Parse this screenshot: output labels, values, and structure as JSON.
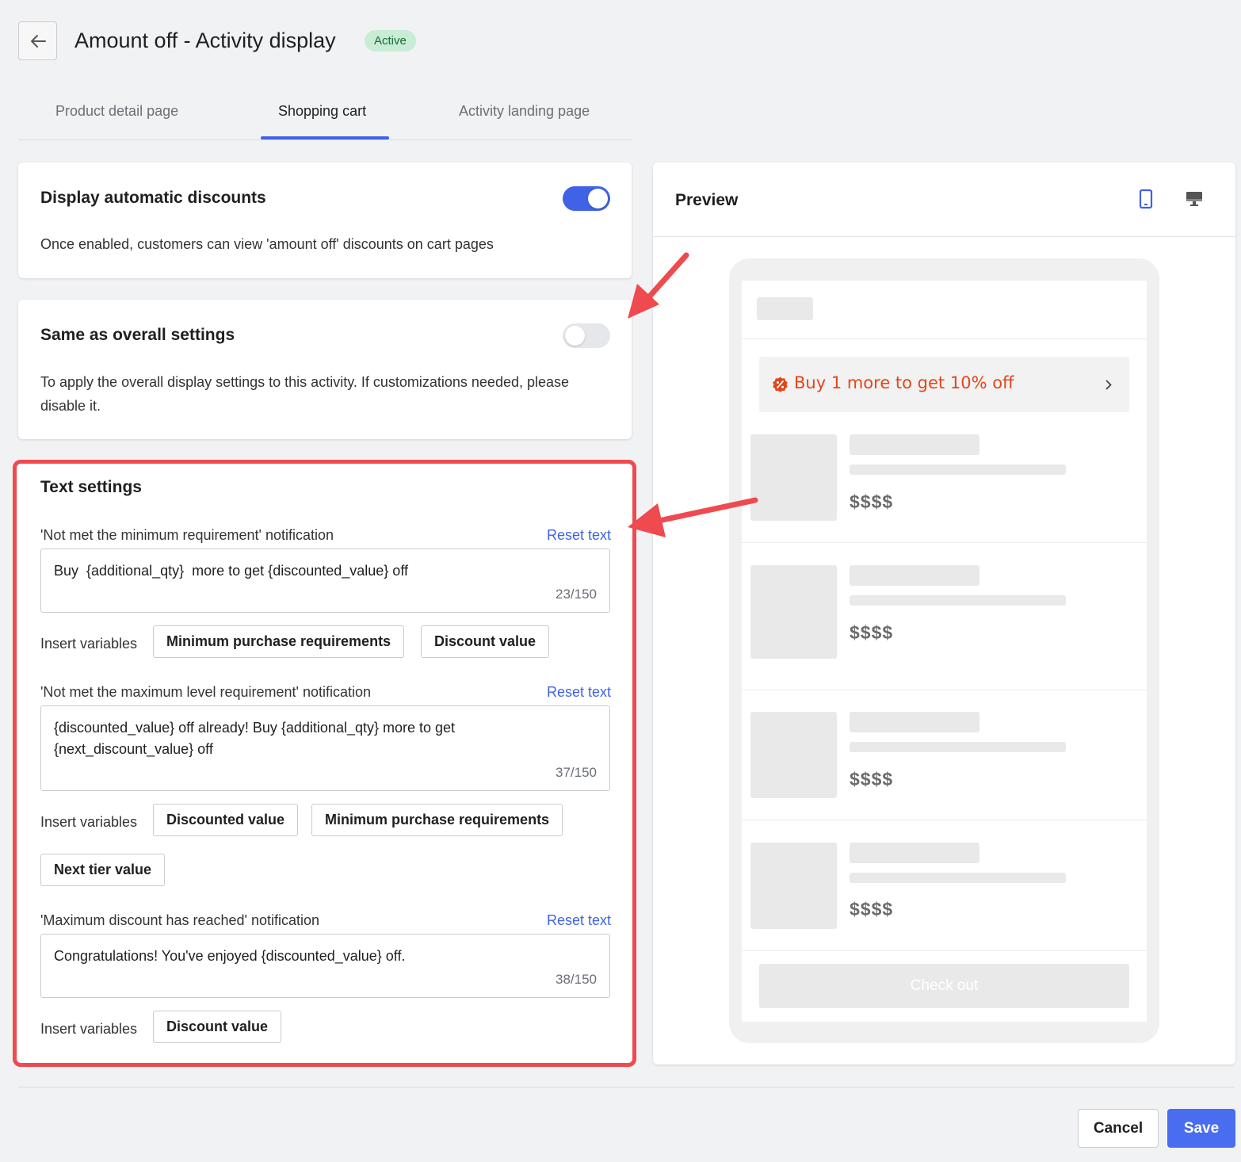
{
  "header": {
    "title": "Amount off - Activity display",
    "status_badge": "Active",
    "back_icon": "arrow-left-icon"
  },
  "tabs": [
    {
      "label": "Product detail page",
      "active": false
    },
    {
      "label": "Shopping cart",
      "active": true
    },
    {
      "label": "Activity landing page",
      "active": false
    }
  ],
  "display_discounts": {
    "title": "Display automatic discounts",
    "description": "Once enabled, customers can view 'amount off' discounts on cart pages",
    "enabled": true
  },
  "same_as_overall": {
    "title": "Same as overall settings",
    "description": "To apply the overall display settings to this activity. If customizations needed, please disable it.",
    "enabled": false
  },
  "text_settings": {
    "title": "Text settings",
    "reset_label": "Reset text",
    "insert_label": "Insert variables",
    "not_met_min": {
      "label": "'Not met the minimum requirement' notification",
      "value": "Buy  {additional_qty}  more to get {discounted_value} off",
      "count": "23/150",
      "variables": [
        "Minimum purchase requirements",
        "Discount value"
      ]
    },
    "not_met_max": {
      "label": "'Not met the maximum level requirement' notification",
      "value": "{discounted_value} off already! Buy {additional_qty} more to get\n{next_discount_value} off",
      "count": "37/150",
      "variables": [
        "Discounted value",
        "Minimum purchase requirements",
        "Next tier value"
      ]
    },
    "max_reached": {
      "label": "'Maximum discount has reached' notification",
      "value": "Congratulations! You've enjoyed {discounted_value} off.",
      "count": "38/150",
      "variables": [
        "Discount value"
      ]
    }
  },
  "preview": {
    "title": "Preview",
    "device_icons": [
      "mobile-icon",
      "desktop-icon"
    ],
    "promo_text": "Buy 1 more to get 10% off",
    "promo_icon": "discount-badge-icon",
    "prices": [
      "$$$$",
      "$$$$",
      "$$$$",
      "$$$$"
    ],
    "checkout_label": "Check out"
  },
  "footer": {
    "cancel_label": "Cancel",
    "save_label": "Save"
  },
  "colors": {
    "accent": "#3f62e6",
    "highlight": "#ee4a4f",
    "promo": "#e2461a",
    "badge_bg": "#c8ecd5"
  }
}
